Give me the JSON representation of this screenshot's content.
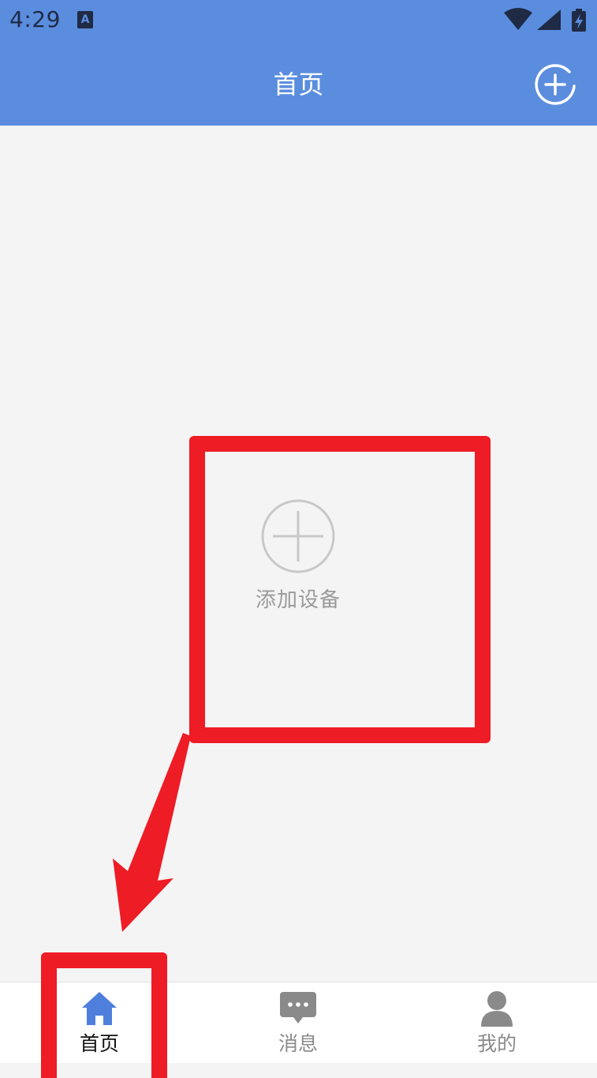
{
  "status_bar": {
    "time": "4:29",
    "notification_icon": "A",
    "icons": [
      "wifi-icon",
      "cell-signal-icon",
      "battery-charging-icon"
    ]
  },
  "header": {
    "title": "首页",
    "add_icon": "add-circle-icon"
  },
  "main": {
    "add_device_label": "添加设备",
    "add_device_icon": "add-circle-icon"
  },
  "tabs": [
    {
      "label": "首页",
      "icon": "home-icon",
      "active": true
    },
    {
      "label": "消息",
      "icon": "message-icon",
      "active": false
    },
    {
      "label": "我的",
      "icon": "person-icon",
      "active": false
    }
  ],
  "colors": {
    "primary": "#5b8ddf",
    "annotation": "#ee1c25",
    "background": "#f4f4f4",
    "icon_inactive": "#8a8a8a"
  }
}
